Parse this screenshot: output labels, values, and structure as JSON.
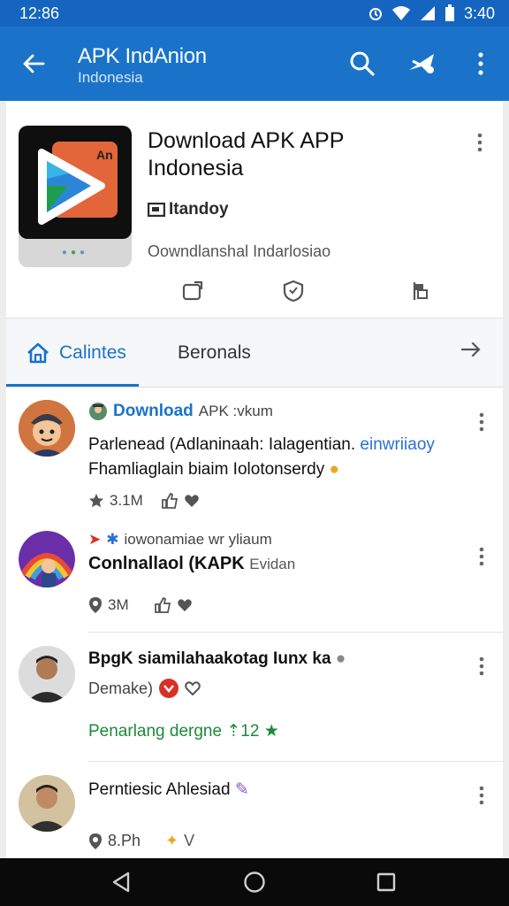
{
  "status": {
    "time": "12:86",
    "battery_time": "3:40"
  },
  "app_bar": {
    "title": "APK IndAnion",
    "subtitle": "Indonesia"
  },
  "app": {
    "name_line1": "Download APK APP",
    "name_line2": "Indonesia",
    "developer": "Itandoy",
    "description": "Oowndlanshal Indarlosiao",
    "logo_badge": "An"
  },
  "tabs": {
    "active": "Calintes",
    "second": "Beronals"
  },
  "feed": [
    {
      "meta_link": "Download",
      "meta_rest": "APK :vkum",
      "text_line1": "Parlenead (Adlaninaah: Ialagentian.",
      "text_line1_accent": "einwriiaoy",
      "text_line2": "Fhamliaglain biaim Iolotonserdy",
      "stat": "3.1M"
    },
    {
      "meta": "iowonamiae wr yliaum",
      "title": "Conlnallaol (KAPK",
      "title_rest": "Evidan",
      "stat": "3M"
    },
    {
      "title": "BpgK siamilahaakotag Iunx ka",
      "line2": "Demake)",
      "green": "Penarlang dergne",
      "green_num": "12"
    },
    {
      "title": "Perntiesic Ahlesiad",
      "stat": "8.Ph"
    }
  ],
  "colors": {
    "primary": "#1a73c8",
    "status": "#1565c0",
    "green": "#1c8a3a",
    "red": "#d93025"
  }
}
